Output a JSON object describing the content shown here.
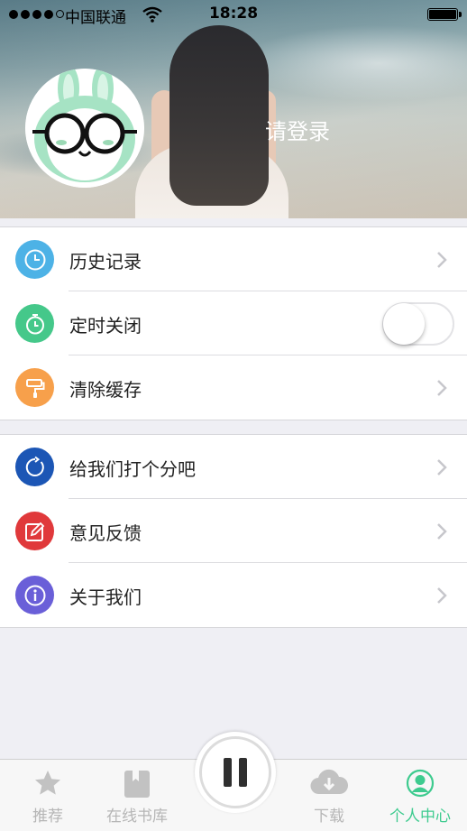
{
  "status_bar": {
    "carrier": "中国联通",
    "time": "18:28"
  },
  "profile": {
    "login_text": "请登录"
  },
  "menu_group_1": [
    {
      "label": "历史记录",
      "icon": "clock-icon",
      "color": "#4db2e6",
      "accessory": "chevron"
    },
    {
      "label": "定时关闭",
      "icon": "timer-icon",
      "color": "#45c88a",
      "accessory": "toggle",
      "toggle_on": false
    },
    {
      "label": "清除缓存",
      "icon": "paint-roller-icon",
      "color": "#f7a04b",
      "accessory": "chevron"
    }
  ],
  "menu_group_2": [
    {
      "label": "给我们打个分吧",
      "icon": "rate-icon",
      "color": "#1c56b5",
      "accessory": "chevron"
    },
    {
      "label": "意见反馈",
      "icon": "feedback-icon",
      "color": "#e0393b",
      "accessory": "chevron"
    },
    {
      "label": "关于我们",
      "icon": "info-icon",
      "color": "#6a5fd8",
      "accessory": "chevron"
    }
  ],
  "tab_bar": {
    "tabs": [
      {
        "label": "推荐",
        "icon": "star-icon"
      },
      {
        "label": "在线书库",
        "icon": "book-icon"
      },
      {
        "label": "下载",
        "icon": "cloud-download-icon"
      },
      {
        "label": "个人中心",
        "icon": "person-icon",
        "active": true
      }
    ],
    "player_state": "playing"
  },
  "colors": {
    "accent": "#3ecb8f",
    "background": "#efeff4"
  }
}
